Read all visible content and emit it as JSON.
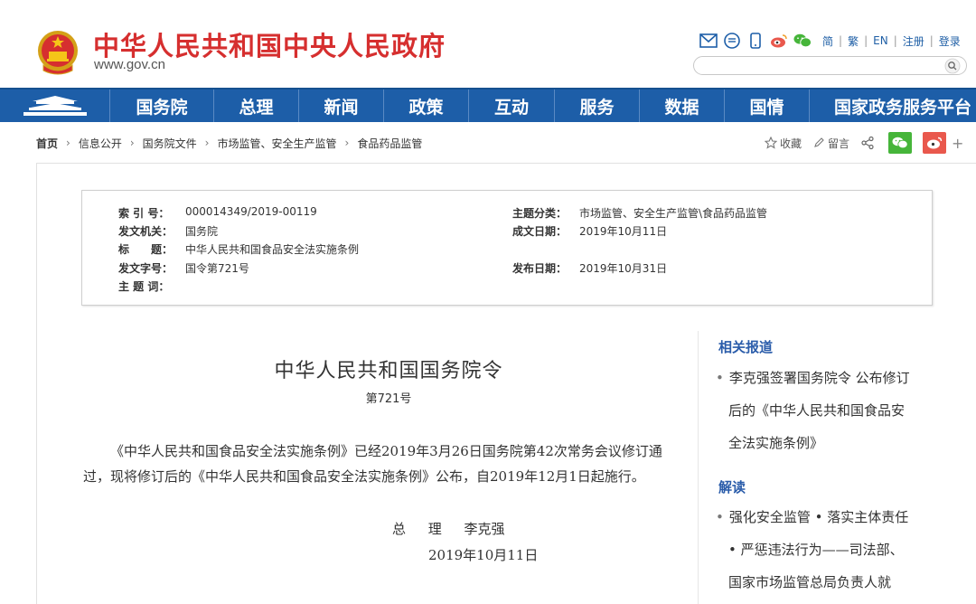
{
  "header": {
    "title": "中华人民共和国中央人民政府",
    "url": "www.gov.cn",
    "lang": [
      "简",
      "繁",
      "EN",
      "注册",
      "登录"
    ],
    "search_placeholder": ""
  },
  "nav": {
    "items": [
      "国务院",
      "总理",
      "新闻",
      "政策",
      "互动",
      "服务",
      "数据",
      "国情",
      "国家政务服务平台"
    ]
  },
  "breadcrumb": {
    "items": [
      "首页",
      "信息公开",
      "国务院文件",
      "市场监管、安全生产监管",
      "食品药品监管"
    ]
  },
  "share": {
    "favorite": "收藏",
    "comment": "留言"
  },
  "meta": {
    "index_label": "索 引 号：",
    "index_value": "000014349/2019-00119",
    "issuer_label": "发文机关：",
    "issuer_value": "国务院",
    "title_label": "标　　题：",
    "title_value": "中华人民共和国食品安全法实施条例",
    "docno_label": "发文字号：",
    "docno_value": "国令第721号",
    "keywords_label": "主 题 词：",
    "topic_label": "主题分类：",
    "topic_value": "市场监管、安全生产监管\\食品药品监管",
    "created_label": "成文日期：",
    "created_value": "2019年10月11日",
    "published_label": "发布日期：",
    "published_value": "2019年10月31日"
  },
  "article": {
    "title": "中华人民共和国国务院令",
    "number": "第721号",
    "body": "《中华人民共和国食品安全法实施条例》已经2019年3月26日国务院第42次常务会议修订通过，现将修订后的《中华人民共和国食品安全法实施条例》公布，自2019年12月1日起施行。",
    "signature": "总 理 李克强",
    "date": "2019年10月11日"
  },
  "sidebar": {
    "related_heading": "相关报道",
    "related_lines": [
      "李克强签署国务院令 公布修订",
      "后的《中华人民共和国食品安",
      "全法实施条例》"
    ],
    "interpret_heading": "解读",
    "interpret_lines": [
      "强化安全监管 • 落实主体责任",
      "• 严惩违法行为——司法部、",
      "国家市场监管总局负责人就"
    ]
  },
  "colors": {
    "brand_red": "#d62f2f",
    "nav_blue": "#1d5ea8",
    "link_blue": "#2a5caa",
    "wechat_green": "#46b53a",
    "weibo_red": "#e9584d"
  }
}
